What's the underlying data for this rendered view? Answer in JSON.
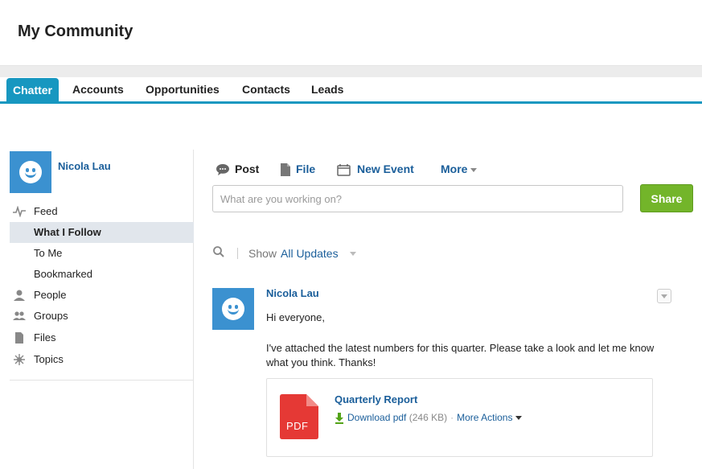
{
  "header": {
    "title": "My Community"
  },
  "tabs": [
    {
      "label": "Chatter",
      "active": true
    },
    {
      "label": "Accounts"
    },
    {
      "label": "Opportunities"
    },
    {
      "label": "Contacts"
    },
    {
      "label": "Leads"
    }
  ],
  "sidebar": {
    "user_name": "Nicola Lau",
    "items": [
      {
        "label": "Feed",
        "icon": "feed-icon"
      },
      {
        "label": "What I Follow",
        "selected": true
      },
      {
        "label": "To Me"
      },
      {
        "label": "Bookmarked"
      },
      {
        "label": "People",
        "icon": "person-icon"
      },
      {
        "label": "Groups",
        "icon": "groups-icon"
      },
      {
        "label": "Files",
        "icon": "file-icon"
      },
      {
        "label": "Topics",
        "icon": "topics-icon"
      }
    ]
  },
  "publisher": {
    "post": "Post",
    "file": "File",
    "new_event": "New Event",
    "more": "More",
    "placeholder": "What are you working on?",
    "share": "Share"
  },
  "filter": {
    "show_label": "Show",
    "show_value": "All Updates"
  },
  "feed_item": {
    "author": "Nicola Lau",
    "line1": "Hi everyone,",
    "line2": "I've attached the latest numbers for this quarter. Please take a look and let me know what you think. Thanks!",
    "attachment": {
      "title": "Quarterly Report",
      "type_label": "PDF",
      "download": "Download pdf",
      "size": "(246 KB)",
      "more_actions": "More Actions"
    }
  },
  "colors": {
    "accent": "#1797c0",
    "link": "#1a5e9a",
    "share": "#73b52a",
    "avatar": "#3b91d0",
    "pdf": "#e53935"
  }
}
